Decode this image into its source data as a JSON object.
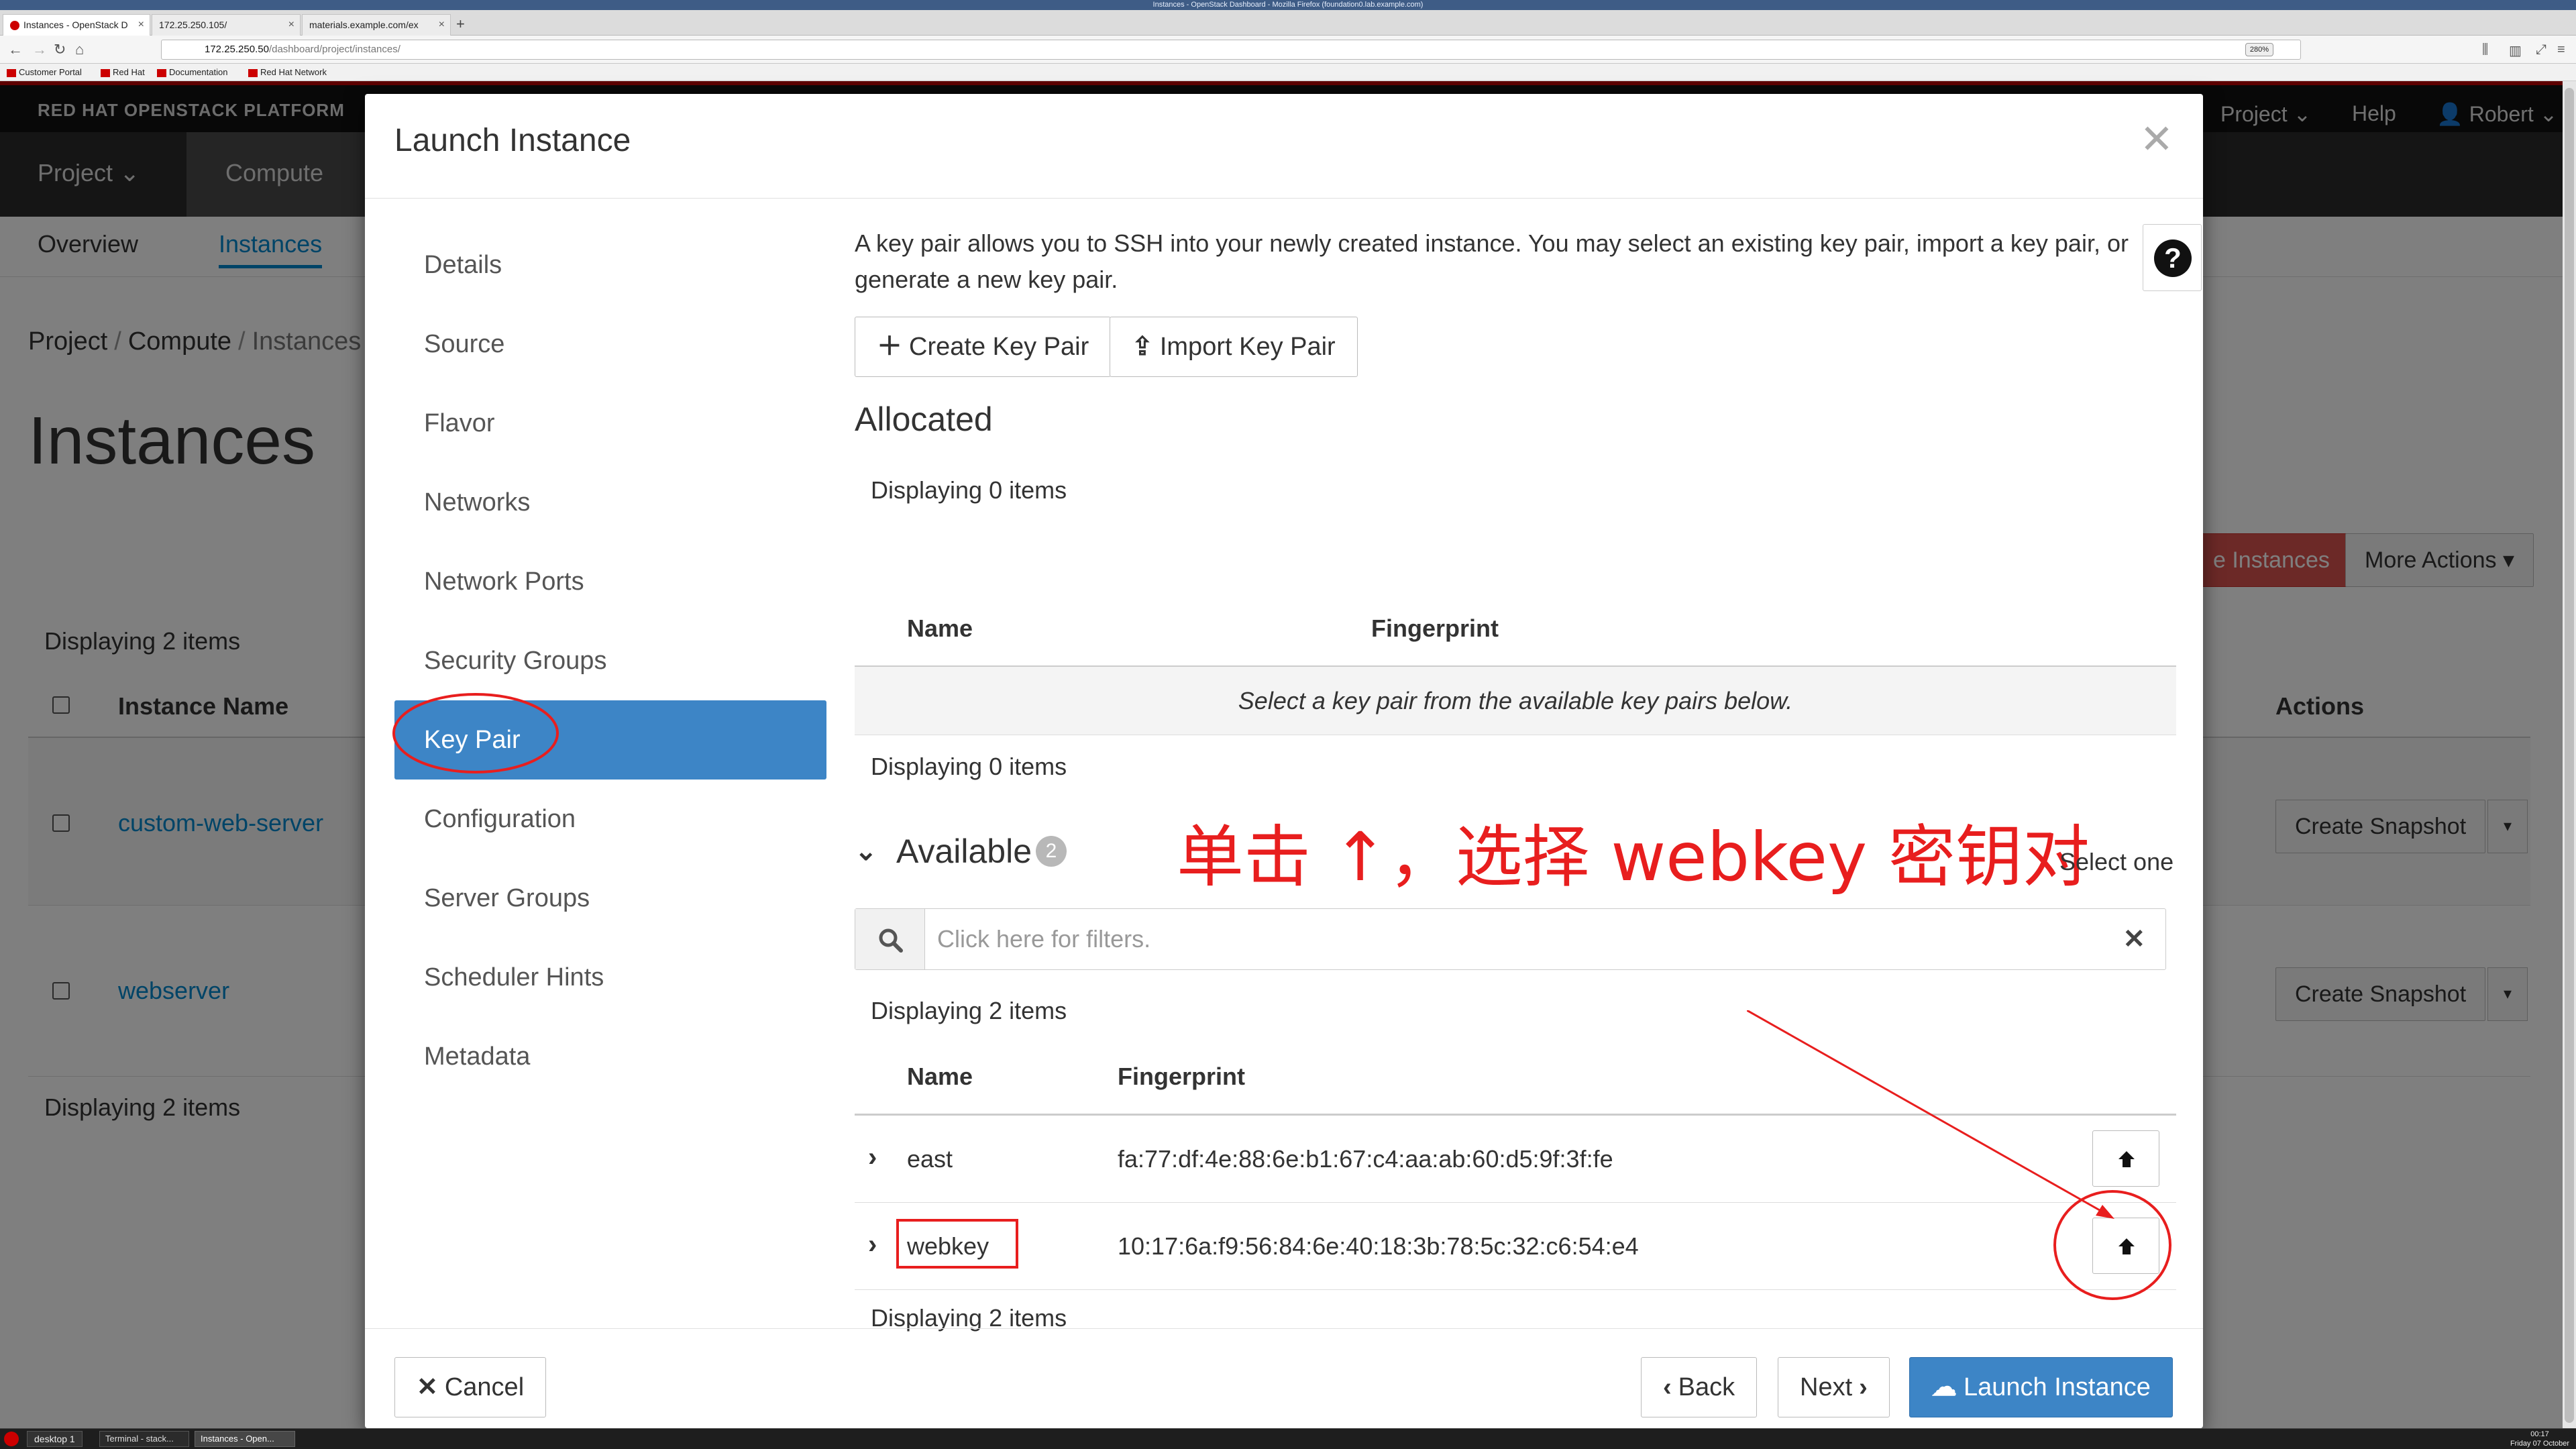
{
  "browser": {
    "window_title": "Instances - OpenStack Dashboard - Mozilla Firefox (foundation0.lab.example.com)",
    "tabs": [
      {
        "label": "Instances - OpenStack D"
      },
      {
        "label": "172.25.250.105/"
      },
      {
        "label": "materials.example.com/ex"
      }
    ],
    "url_host": "172.25.250.50",
    "url_path": "/dashboard/project/instances/",
    "zoom": "280%",
    "bookmarks": [
      "Customer Portal",
      "Red Hat",
      "Documentation",
      "Red Hat Network"
    ]
  },
  "dashboard": {
    "brand": "RED HAT OPENSTACK PLATFORM",
    "top_nav": {
      "project": "Project",
      "help": "Help",
      "user": "Robert"
    },
    "sec_nav": {
      "project": "Project",
      "compute": "Compute"
    },
    "tert_nav": {
      "overview": "Overview",
      "instances": "Instances"
    },
    "breadcrumb": [
      "Project",
      "Compute",
      "Instances"
    ],
    "page_title": "Instances",
    "displaying": "Displaying 2 items",
    "launch_btn_partial": "e Instances",
    "more_actions": "More Actions",
    "col_instance_name": "Instance Name",
    "col_actions": "Actions",
    "rows": [
      {
        "name": "custom-web-server",
        "action": "Create Snapshot"
      },
      {
        "name": "webserver",
        "action": "Create Snapshot"
      }
    ]
  },
  "modal": {
    "title": "Launch Instance",
    "wizard_steps": [
      "Details",
      "Source",
      "Flavor",
      "Networks",
      "Network Ports",
      "Security Groups",
      "Key Pair",
      "Configuration",
      "Server Groups",
      "Scheduler Hints",
      "Metadata"
    ],
    "active_step": "Key Pair",
    "help_text": "A key pair allows you to SSH into your newly created instance. You may select an existing key pair, import a key pair, or generate a new key pair.",
    "create_key_pair": "Create Key Pair",
    "import_key_pair": "Import Key Pair",
    "allocated": {
      "title": "Allocated",
      "displaying_top": "Displaying 0 items",
      "col_name": "Name",
      "col_fingerprint": "Fingerprint",
      "empty_message": "Select a key pair from the available key pairs below.",
      "displaying_bottom": "Displaying 0 items"
    },
    "available": {
      "title": "Available",
      "count": "2",
      "select_one": "Select one",
      "search_placeholder": "Click here for filters.",
      "displaying_top": "Displaying 2 items",
      "col_name": "Name",
      "col_fingerprint": "Fingerprint",
      "rows": [
        {
          "name": "east",
          "fingerprint": "fa:77:df:4e:88:6e:b1:67:c4:aa:ab:60:d5:9f:3f:fe"
        },
        {
          "name": "webkey",
          "fingerprint": "10:17:6a:f9:56:84:6e:40:18:3b:78:5c:32:c6:54:e4"
        }
      ],
      "displaying_bottom": "Displaying 2 items"
    },
    "annotation": "单击 ↑，选择 webkey 密钥对",
    "footer": {
      "cancel": "Cancel",
      "back": "Back",
      "next": "Next",
      "launch": "Launch Instance"
    }
  },
  "taskbar": {
    "items": [
      "desktop 1",
      "Terminal - stack...",
      "Instances - Open..."
    ],
    "clock_time": "00:17",
    "clock_date": "Friday 07 October"
  },
  "colors": {
    "accent": "#3d85c6",
    "annotation_red": "#e81e1e",
    "brand_red": "#bb0000"
  }
}
